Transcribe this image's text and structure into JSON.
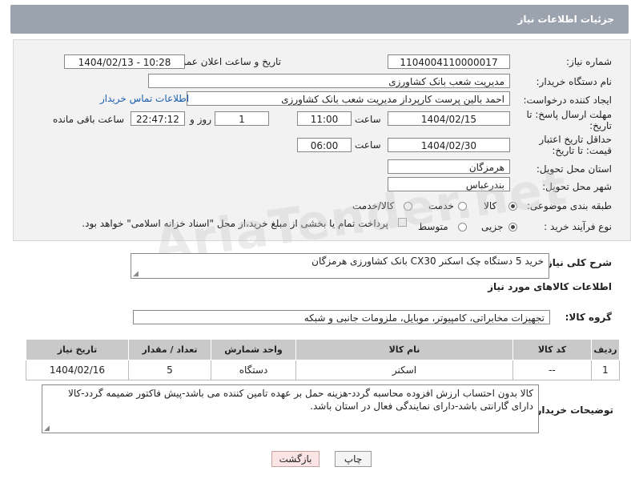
{
  "header": {
    "title": "جزئیات اطلاعات نیاز"
  },
  "form": {
    "need_number_label": "شماره نیاز:",
    "need_number": "1104004110000017",
    "announce_label": "تاریخ و ساعت اعلان عمومی:",
    "announce_value": "1404/02/13 - 10:28",
    "buyer_org_label": "نام دستگاه خریدار:",
    "buyer_org": "مدیریت شعب بانک کشاورزی",
    "creator_label": "ایجاد کننده درخواست:",
    "creator": "احمد بالین پرست  کارپرداز مدیریت شعب بانک کشاورزی",
    "contact_link": "اطلاعات تماس خریدار",
    "deadline_label": "مهلت ارسال پاسخ: تا تاریخ:",
    "deadline_date": "1404/02/15",
    "time_label": "ساعت",
    "deadline_time": "11:00",
    "days_value": "1",
    "days_label": "روز و",
    "remaining_time": "22:47:12",
    "remaining_label": "ساعت باقی مانده",
    "validity_label": "حداقل تاریخ اعتبار قیمت: تا تاریخ:",
    "validity_date": "1404/02/30",
    "validity_time": "06:00",
    "province_label": "استان محل تحویل:",
    "province": "هرمزگان",
    "city_label": "شهر محل تحویل:",
    "city": "بندرعباس",
    "category_label": "طبقه بندی موضوعی:",
    "category_options": [
      "کالا",
      "خدمت",
      "کالا/خدمت"
    ],
    "process_label": "نوع فرآیند خرید :",
    "process_options": [
      "جزیی",
      "متوسط"
    ],
    "payment_note": "پرداخت تمام یا بخشی از مبلغ خرید،از محل \"اسناد خزانه اسلامی\" خواهد بود."
  },
  "description": {
    "label": "شرح کلی نیاز:",
    "value": "خرید 5 دستگاه چک اسکنر CX30 بانک کشاورزی هرمزگان"
  },
  "goods_section": {
    "title": "اطلاعات کالاهای مورد نیاز",
    "group_label": "گروه کالا:",
    "group_value": "تجهیزات مخابراتی، کامپیوتر، موبایل، ملزومات جانبی و شبکه"
  },
  "table": {
    "headers": [
      "ردیف",
      "کد کالا",
      "نام کالا",
      "واحد شمارش",
      "تعداد / مقدار",
      "تاریخ نیاز"
    ],
    "rows": [
      [
        "1",
        "--",
        "اسکنر",
        "دستگاه",
        "5",
        "1404/02/16"
      ]
    ]
  },
  "buyer_notes": {
    "label": "توضیحات خریدار:",
    "value": "کالا بدون احتساب ارزش افزوده محاسبه گردد-هزینه حمل بر عهده تامین کننده می باشد-پیش فاکتور ضمیمه گردد-کالا دارای گارانتی باشد-دارای نمایندگی فعال در استان باشد."
  },
  "buttons": {
    "print": "چاپ",
    "back": "بازگشت"
  }
}
